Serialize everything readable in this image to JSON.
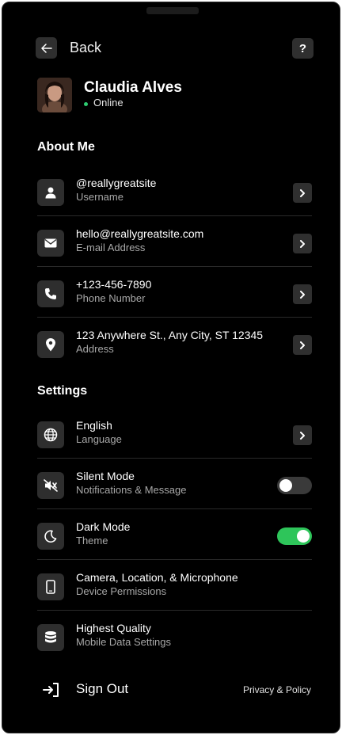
{
  "header": {
    "back_label": "Back",
    "help_label": "?"
  },
  "profile": {
    "name": "Claudia Alves",
    "status": "Online",
    "status_color": "#2ecc71"
  },
  "about": {
    "title": "About Me",
    "items": [
      {
        "value": "@reallygreatsite",
        "label": "Username",
        "icon": "user-icon"
      },
      {
        "value": "hello@reallygreatsite.com",
        "label": "E-mail Address",
        "icon": "mail-icon"
      },
      {
        "value": "+123-456-7890",
        "label": "Phone Number",
        "icon": "phone-icon"
      },
      {
        "value": "123 Anywhere St., Any City, ST 12345",
        "label": "Address",
        "icon": "location-pin-icon"
      }
    ]
  },
  "settings": {
    "title": "Settings",
    "items": [
      {
        "value": "English",
        "label": "Language",
        "icon": "globe-icon",
        "control": "chevron"
      },
      {
        "value": "Silent Mode",
        "label": "Notifications & Message",
        "icon": "mute-icon",
        "control": "toggle",
        "enabled": false
      },
      {
        "value": "Dark Mode",
        "label": "Theme",
        "icon": "moon-icon",
        "control": "toggle",
        "enabled": true
      },
      {
        "value": "Camera, Location, & Microphone",
        "label": "Device Permissions",
        "icon": "device-icon",
        "control": "none"
      },
      {
        "value": "Highest Quality",
        "label": "Mobile Data Settings",
        "icon": "database-icon",
        "control": "none"
      }
    ]
  },
  "footer": {
    "signout_label": "Sign Out",
    "privacy_label": "Privacy & Policy"
  },
  "colors": {
    "background": "#000000",
    "accent_toggle_on": "#2ec55a",
    "card": "#2e2e2e"
  }
}
